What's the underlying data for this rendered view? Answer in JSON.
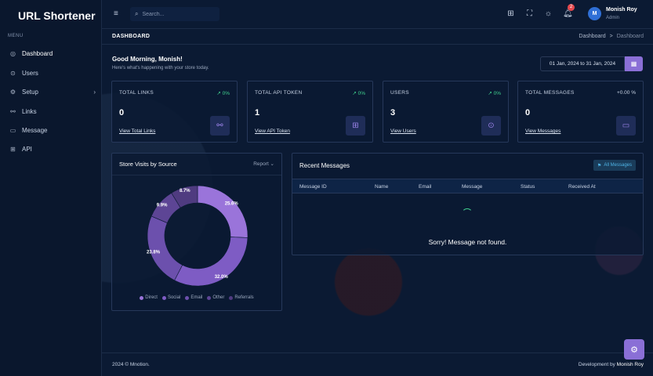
{
  "app": {
    "title": "URL Shortener"
  },
  "sidebar": {
    "menu_title": "MENU",
    "items": [
      {
        "label": "Dashboard",
        "icon": "dashboard-icon"
      },
      {
        "label": "Users",
        "icon": "user-icon"
      },
      {
        "label": "Setup",
        "icon": "gear-icon"
      },
      {
        "label": "Links",
        "icon": "link-icon"
      },
      {
        "label": "Message",
        "icon": "message-icon"
      },
      {
        "label": "API",
        "icon": "grid-icon"
      }
    ]
  },
  "topbar": {
    "search_placeholder": "Search...",
    "notification_count": "2",
    "user": {
      "initial": "M",
      "name": "Monish Roy",
      "role": "Admin"
    }
  },
  "page": {
    "title": "DASHBOARD",
    "breadcrumb": [
      "Dashboard",
      ">",
      "Dashboard"
    ]
  },
  "greeting": {
    "title": "Good Morning, Monish!",
    "subtitle": "Here's what's happening with your store today."
  },
  "date_range": "01 Jan, 2024 to 31 Jan, 2024",
  "cards": [
    {
      "label": "TOTAL LINKS",
      "delta": "↗ 0%",
      "value": "0",
      "link": "View Total Links",
      "icon": "link-icon"
    },
    {
      "label": "TOTAL API TOKEN",
      "delta": "↗ 0%",
      "value": "1",
      "link": "View API Token",
      "icon": "grid-icon"
    },
    {
      "label": "USERS",
      "delta": "↗ 0%",
      "value": "3",
      "link": "View Users",
      "icon": "user-icon"
    },
    {
      "label": "TOTAL MESSAGES",
      "delta": "+0.00 %",
      "value": "0",
      "link": "View Messages",
      "icon": "message-icon"
    }
  ],
  "store_visits": {
    "title": "Store Visits by Source",
    "action": "Report ⌄"
  },
  "chart_data": {
    "type": "pie",
    "donut": true,
    "categories": [
      "Direct",
      "Social",
      "Email",
      "Other",
      "Referrals"
    ],
    "values": [
      25.6,
      32.0,
      23.8,
      9.9,
      8.7
    ],
    "labels": [
      "25.6%",
      "32.0%",
      "23.8%",
      "9.9%",
      "8.7%"
    ],
    "colors": [
      "#9a74da",
      "#7e5cc4",
      "#6c50ad",
      "#5d4595",
      "#4f3b80"
    ],
    "legend": "bottom"
  },
  "messages": {
    "title": "Recent Messages",
    "all_label": "All Messages",
    "columns": [
      "Message ID",
      "Name",
      "Email",
      "Message",
      "Status",
      "Received At"
    ],
    "empty_text": "Sorry! Message not found."
  },
  "footer": {
    "copyright": "2024 © Mnotion.",
    "dev_prefix": "Development by",
    "dev_name": "Monish Roy"
  }
}
